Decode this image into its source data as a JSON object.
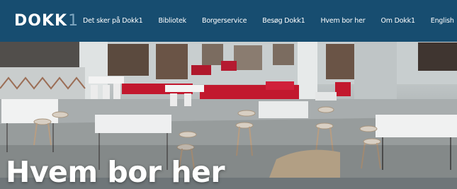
{
  "header": {
    "logo_text": "DOKK",
    "logo_number": "1",
    "nav": [
      {
        "label": "Det sker på Dokk1"
      },
      {
        "label": "Bibliotek"
      },
      {
        "label": "Borgerservice"
      },
      {
        "label": "Besøg Dokk1"
      },
      {
        "label": "Hvem bor her"
      },
      {
        "label": "Om Dokk1"
      },
      {
        "label": "English"
      }
    ]
  },
  "hero": {
    "title": "Hvem bor her",
    "image_description": "library-interior-photo"
  },
  "colors": {
    "navbar": "#174d70",
    "accent_red": "#c2182e",
    "title_text": "#ffffff"
  }
}
